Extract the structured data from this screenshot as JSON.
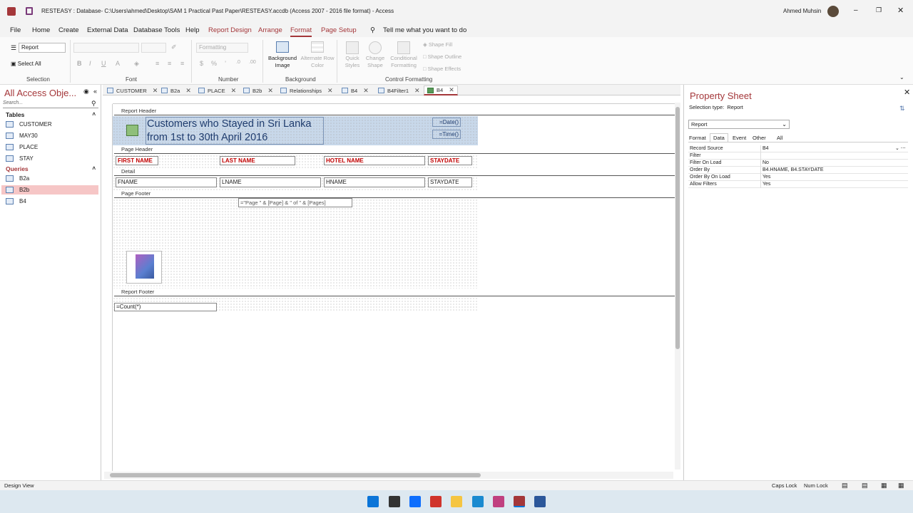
{
  "window": {
    "title": "RESTEASY : Database- C:\\Users\\ahmed\\Desktop\\SAM 1 Practical Past Paper\\RESTEASY.accdb (Access 2007 - 2016 file format)  -  Access",
    "user": "Ahmed Muhsin"
  },
  "menu": [
    "File",
    "Home",
    "Create",
    "External Data",
    "Database Tools",
    "Help",
    "Report Design",
    "Arrange",
    "Format",
    "Page Setup"
  ],
  "tell_me": "Tell me what you want to do",
  "ribbon": {
    "selection_combo": "Report",
    "select_all": "Select All",
    "number_format": "Formatting",
    "background_image": "Background Image",
    "alternate_row_color": "Alternate Row Color",
    "quick_styles": "Quick Styles",
    "change_shape": "Change Shape",
    "conditional_formatting": "Conditional Formatting",
    "shape_fill": "Shape Fill",
    "shape_outline": "Shape Outline",
    "shape_effects": "Shape Effects",
    "groups": {
      "selection": "Selection",
      "font": "Font",
      "number": "Number",
      "background": "Background",
      "control_formatting": "Control Formatting"
    }
  },
  "nav": {
    "title": "All Access Obje...",
    "search_placeholder": "Search...",
    "tables_label": "Tables",
    "tables": [
      "CUSTOMER",
      "MAY30",
      "PLACE",
      "STAY"
    ],
    "queries_label": "Queries",
    "queries": [
      "B2a",
      "B2b",
      "B4"
    ]
  },
  "tabs": [
    "CUSTOMER",
    "B2a",
    "PLACE",
    "B2b",
    "Relationships",
    "B4",
    "B4Filter1",
    "B4"
  ],
  "report": {
    "report_header_label": "Report Header",
    "title": "Customers who Stayed in Sri Lanka from 1st to 30th April 2016",
    "date_expr": "=Date()",
    "time_expr": "=Time()",
    "page_header_label": "Page Header",
    "column_labels": [
      "FIRST NAME",
      "LAST NAME",
      "HOTEL NAME",
      "STAYDATE"
    ],
    "detail_label": "Detail",
    "fields": [
      "FNAME",
      "LNAME",
      "HNAME",
      "STAYDATE"
    ],
    "page_footer_label": "Page Footer",
    "page_expr": "=\"Page \" & [Page] & \" of \" & [Pages]",
    "report_footer_label": "Report Footer",
    "count_expr": "=Count(*)"
  },
  "property_sheet": {
    "title": "Property Sheet",
    "selection_type": "Selection type:  Report",
    "object": "Report",
    "tabs": [
      "Format",
      "Data",
      "Event",
      "Other",
      "All"
    ],
    "rows": [
      {
        "key": "Record Source",
        "value": "B4"
      },
      {
        "key": "Filter",
        "value": ""
      },
      {
        "key": "Filter On Load",
        "value": "No"
      },
      {
        "key": "Order By",
        "value": "B4.HNAME, B4.STAYDATE"
      },
      {
        "key": "Order By On Load",
        "value": "Yes"
      },
      {
        "key": "Allow Filters",
        "value": "Yes"
      }
    ]
  },
  "status": {
    "mode": "Design View",
    "caps": "Caps Lock",
    "num": "Num Lock"
  }
}
